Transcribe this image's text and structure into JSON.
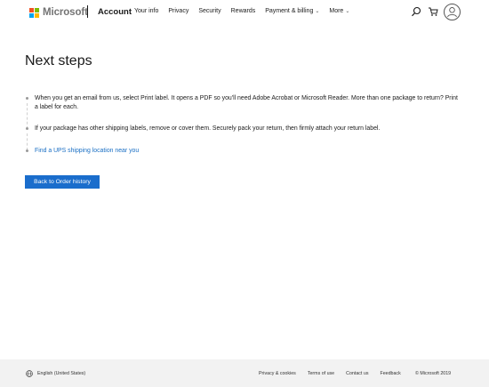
{
  "header": {
    "brand": "Microsoft",
    "account_title": "Account",
    "nav": [
      {
        "label": "Your info",
        "has_chevron": false
      },
      {
        "label": "Privacy",
        "has_chevron": false
      },
      {
        "label": "Security",
        "has_chevron": false
      },
      {
        "label": "Rewards",
        "has_chevron": false
      },
      {
        "label": "Payment & billing",
        "has_chevron": true
      },
      {
        "label": "More",
        "has_chevron": true
      }
    ],
    "icons": [
      "search-icon",
      "cart-icon",
      "avatar-icon"
    ],
    "logo_colors": [
      "#f25022",
      "#7fba00",
      "#00a4ef",
      "#ffb900"
    ]
  },
  "main": {
    "title": "Next steps",
    "steps": [
      {
        "text": "When you get an email from us, select Print label. It opens a PDF so you'll need Adobe Acrobat or Microsoft Reader. More than one package to return? Print a label for each.",
        "is_link": false
      },
      {
        "text": "If your package has other shipping labels, remove or cover them. Securely pack your return, then firmly attach your return label.",
        "is_link": false
      },
      {
        "text": "Find a UPS shipping location near you",
        "is_link": true
      }
    ],
    "back_button": "Back to Order history",
    "accent_color": "#1a6dcc"
  },
  "footer": {
    "language": "English (United States)",
    "links": [
      "Privacy & cookies",
      "Terms of use",
      "Contact us",
      "Feedback"
    ],
    "copyright": "© Microsoft 2019"
  }
}
